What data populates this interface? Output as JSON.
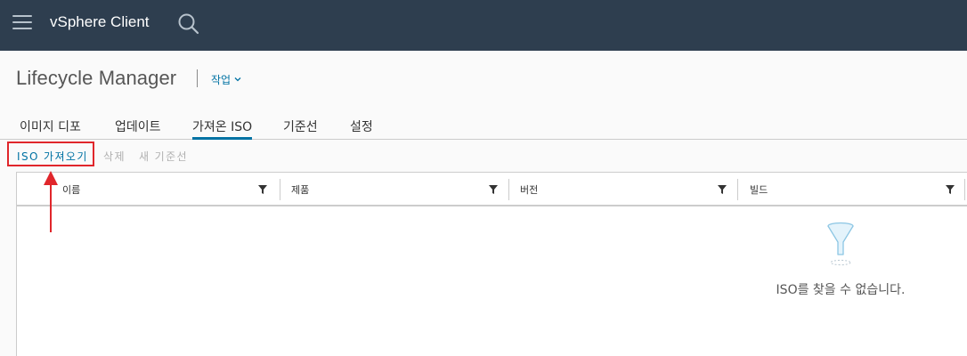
{
  "header": {
    "app_title": "vSphere Client",
    "menu_icon": "hamburger-menu-icon",
    "search_icon": "search-icon",
    "background": "#2e3e4f"
  },
  "page": {
    "title": "Lifecycle Manager",
    "actions_label": "작업"
  },
  "tabs": [
    {
      "label": "이미지 디포",
      "active": false
    },
    {
      "label": "업데이트",
      "active": false
    },
    {
      "label": "가져온 ISO",
      "active": true
    },
    {
      "label": "기준선",
      "active": false
    },
    {
      "label": "설정",
      "active": false
    }
  ],
  "toolbar": {
    "import_iso": "ISO 가져오기",
    "delete": "삭제",
    "new_baseline": "새 기준선"
  },
  "grid": {
    "columns": [
      {
        "label": "이름"
      },
      {
        "label": "제품"
      },
      {
        "label": "버전"
      },
      {
        "label": "빌드"
      }
    ],
    "empty_message": "ISO를 찾을 수 없습니다."
  },
  "colors": {
    "accent": "#0072a3",
    "annotation": "#e0262b",
    "disabled": "#b0b0b0"
  }
}
